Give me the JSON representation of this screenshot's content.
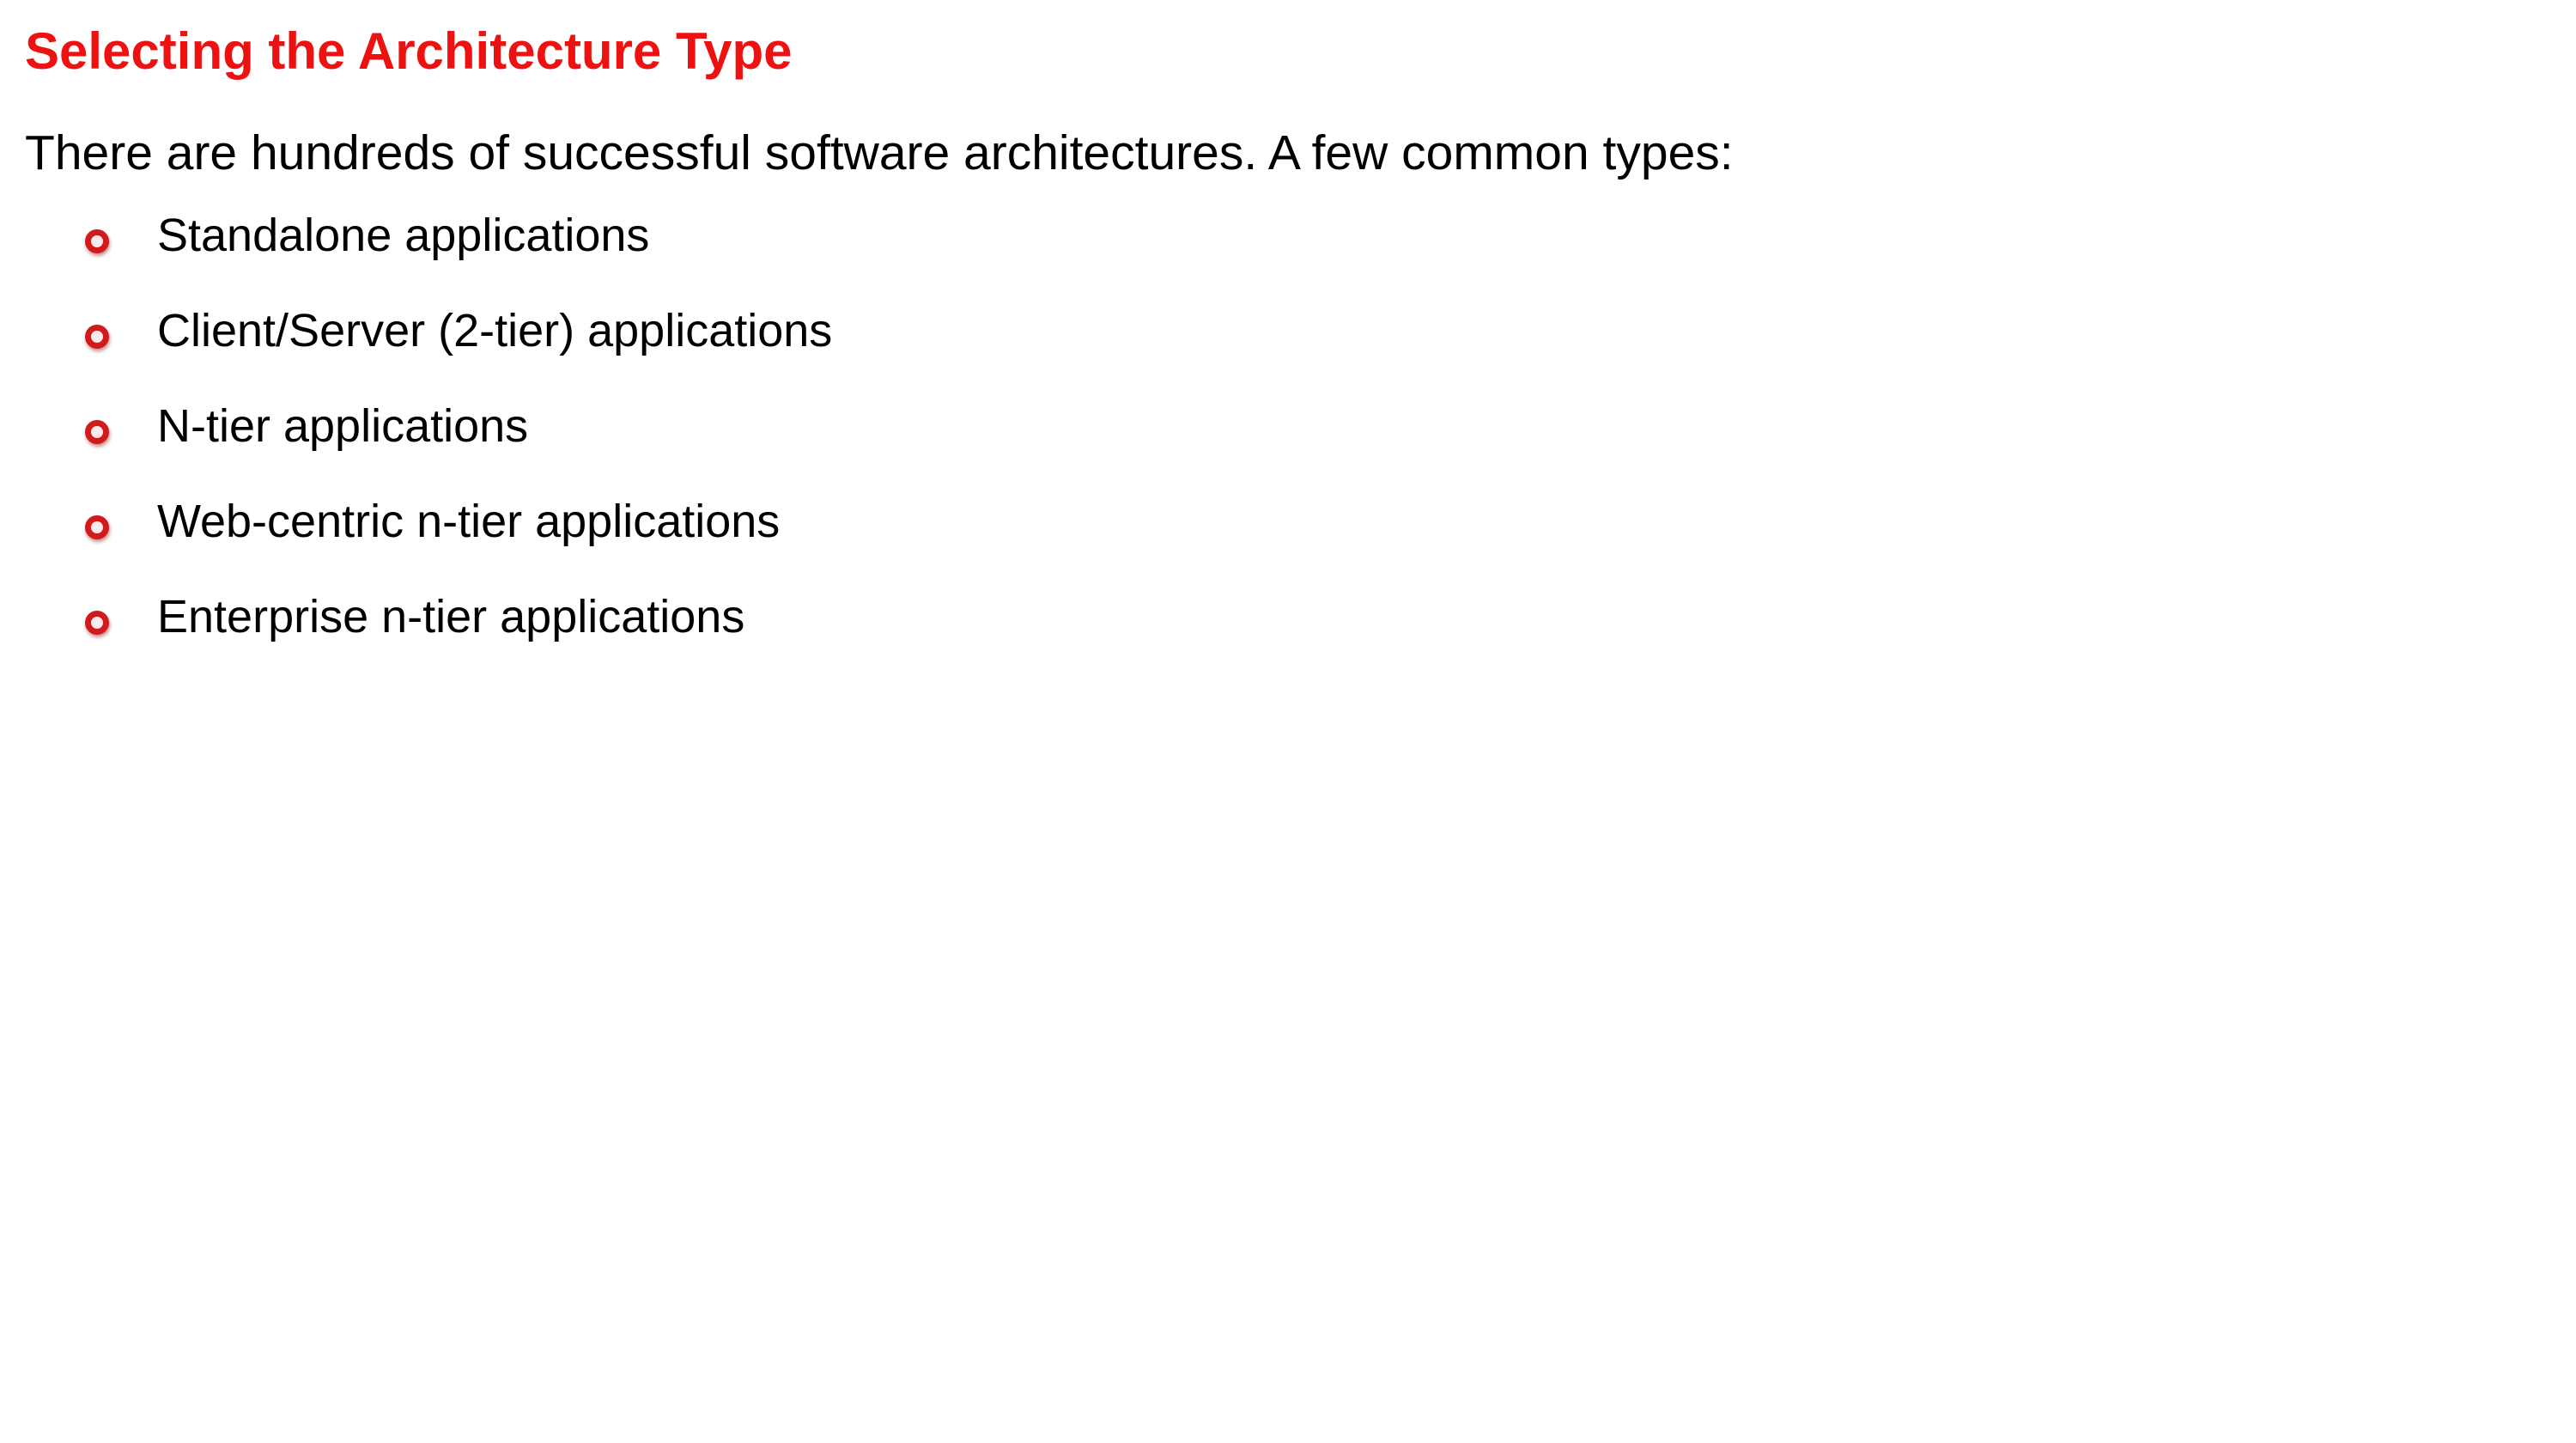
{
  "slide": {
    "title": "Selecting the Architecture Type",
    "intro": "There are hundreds of successful software architectures. A few common types:",
    "bullet_icon": "hollow-circle-bullet-icon",
    "accent_color": "#ee1111",
    "items": [
      {
        "label": "Standalone applications"
      },
      {
        "label": "Client/Server (2-tier) applications"
      },
      {
        "label": "N-tier applications"
      },
      {
        "label": "Web-centric n-tier applications"
      },
      {
        "label": "Enterprise n-tier applications"
      }
    ]
  }
}
